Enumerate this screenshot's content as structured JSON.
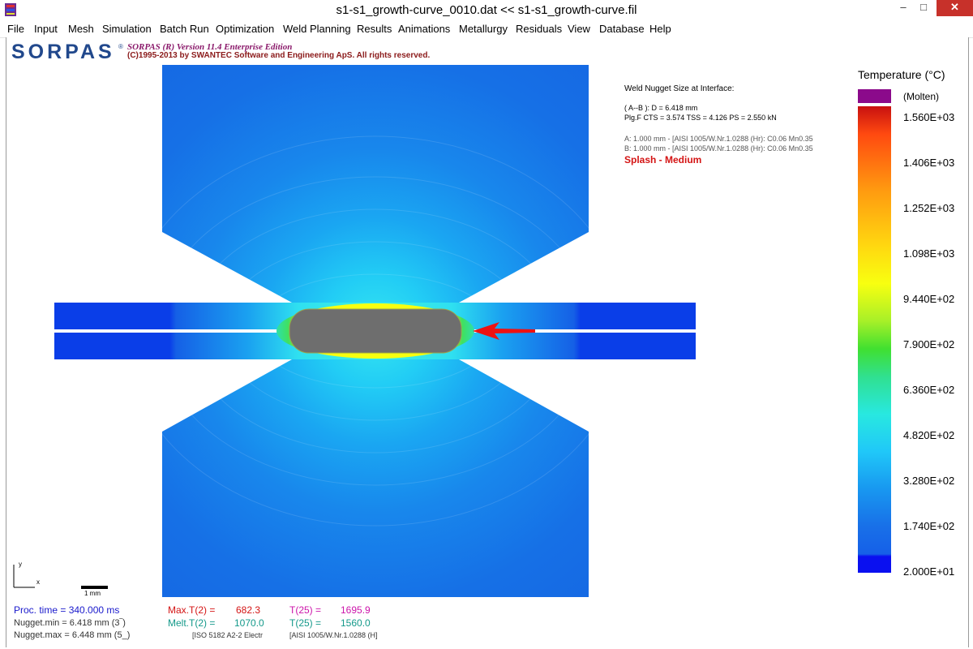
{
  "window": {
    "title": "s1-s1_growth-curve_0010.dat << s1-s1_growth-curve.fil",
    "minimize_glyph": "–",
    "maximize_glyph": "□",
    "close_glyph": "✕"
  },
  "menu": [
    "File",
    "Input",
    "Mesh",
    "Simulation",
    "Batch Run",
    "Optimization",
    "Weld Planning",
    "Results",
    "Animations",
    "Metallurgy",
    "Residuals",
    "View",
    "Database",
    "Help"
  ],
  "header": {
    "logo": "SORPAS",
    "registered": "®",
    "version": "SORPAS (R) Version 11.4  Enterprise Edition",
    "copyright": "(C)1995-2013 by SWANTEC Software and Engineering ApS. All rights reserved."
  },
  "info": {
    "heading": "Weld Nugget Size at Interface:",
    "nugget_line": "( A--B ):  D = 6.418  mm",
    "strength_line": "Plg.F   CTS = 3.574   TSS = 4.126   PS = 2.550  kN",
    "material_a": "A: 1.000 mm - [AISI 1005/W.Nr.1.0288 (Hr): C0.06 Mn0.35",
    "material_b": "B: 1.000 mm - [AISI 1005/W.Nr.1.0288 (Hr): C0.06 Mn0.35",
    "splash": "Splash - Medium"
  },
  "legend": {
    "title": "Temperature (°C)",
    "molten_label": "(Molten)",
    "ticks": [
      "1.560E+03",
      "1.406E+03",
      "1.252E+03",
      "1.098E+03",
      "9.440E+02",
      "7.900E+02",
      "6.360E+02",
      "4.820E+02",
      "3.280E+02",
      "1.740E+02",
      "2.000E+01"
    ],
    "molten_color": "#8b0a8b"
  },
  "axes": {
    "y": "y",
    "x": "x"
  },
  "scale_label": "1 mm",
  "stats": {
    "proc_time": "Proc. time = 340.000 ms",
    "nugget_min": "Nugget.min = 6.418 mm  (3‾)",
    "nugget_max": "Nugget.max = 6.448 mm  (5_)",
    "max_t2_label": "Max.T(2) =",
    "max_t2_value": "682.3",
    "melt_t2_label": "Melt.T(2) =",
    "melt_t2_value": "1070.0",
    "t25a_label": "T(25) =",
    "t25a_value": "1695.9",
    "t25b_label": "T(25) =",
    "t25b_value": "1560.0",
    "footer_iso": "[ISO 5182   A2-2 Electr",
    "footer_mat": "[AISI 1005/W.Nr.1.0288 (H]"
  },
  "colors": {
    "proc_time": "#1a1acc",
    "max_t": "#d41414",
    "melt_t": "#14998a",
    "t25": "#cc14aa",
    "splash": "#d41414",
    "nugget": "#6e6e6e",
    "arrow": "#ee1111"
  }
}
